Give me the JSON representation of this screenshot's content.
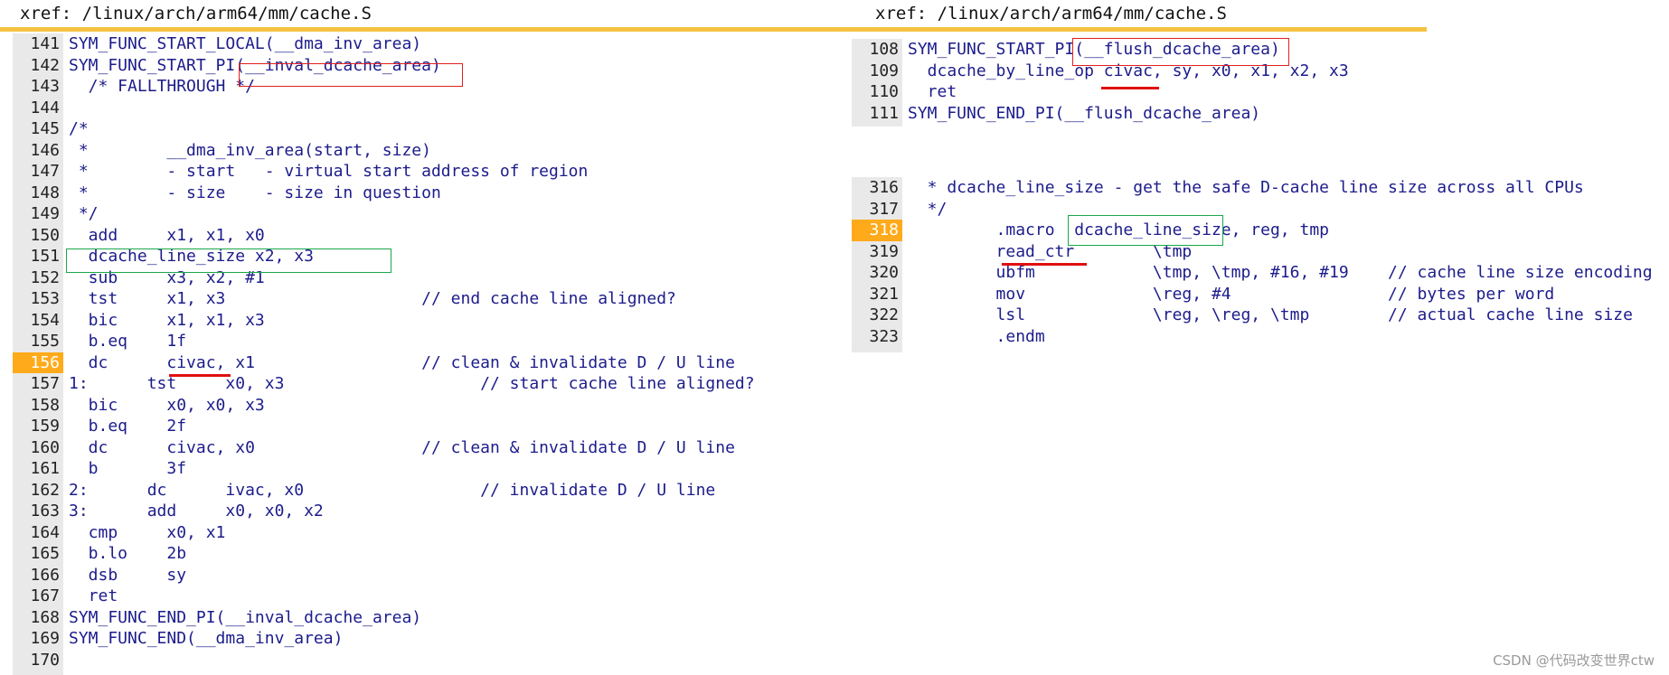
{
  "left": {
    "xref": {
      "prefix": "xref: ",
      "path": "/linux/arch/arm64/mm/cache.S"
    },
    "lines": [
      {
        "n": "141",
        "t": "SYM_FUNC_START_LOCAL(__dma_inv_area)"
      },
      {
        "n": "142",
        "t": "SYM_FUNC_START_PI(__inval_dcache_area)"
      },
      {
        "n": "143",
        "t": "  /* FALLTHROUGH */"
      },
      {
        "n": "144",
        "t": ""
      },
      {
        "n": "145",
        "t": "/*"
      },
      {
        "n": "146",
        "t": " *        __dma_inv_area(start, size)"
      },
      {
        "n": "147",
        "t": " *        - start   - virtual start address of region"
      },
      {
        "n": "148",
        "t": " *        - size    - size in question"
      },
      {
        "n": "149",
        "t": " */"
      },
      {
        "n": "150",
        "t": "  add     x1, x1, x0"
      },
      {
        "n": "151",
        "t": "  dcache_line_size x2, x3"
      },
      {
        "n": "152",
        "t": "  sub     x3, x2, #1"
      },
      {
        "n": "153",
        "t": "  tst     x1, x3                    // end cache line aligned?"
      },
      {
        "n": "154",
        "t": "  bic     x1, x1, x3"
      },
      {
        "n": "155",
        "t": "  b.eq    1f"
      },
      {
        "n": "156",
        "t": "  dc      civac, x1                 // clean & invalidate D / U line",
        "cur": true
      },
      {
        "n": "157",
        "t": "1:      tst     x0, x3                    // start cache line aligned?"
      },
      {
        "n": "158",
        "t": "  bic     x0, x0, x3"
      },
      {
        "n": "159",
        "t": "  b.eq    2f"
      },
      {
        "n": "160",
        "t": "  dc      civac, x0                 // clean & invalidate D / U line"
      },
      {
        "n": "161",
        "t": "  b       3f"
      },
      {
        "n": "162",
        "t": "2:      dc      ivac, x0                  // invalidate D / U line"
      },
      {
        "n": "163",
        "t": "3:      add     x0, x0, x2"
      },
      {
        "n": "164",
        "t": "  cmp     x0, x1"
      },
      {
        "n": "165",
        "t": "  b.lo    2b"
      },
      {
        "n": "166",
        "t": "  dsb     sy"
      },
      {
        "n": "167",
        "t": "  ret"
      },
      {
        "n": "168",
        "t": "SYM_FUNC_END_PI(__inval_dcache_area)"
      },
      {
        "n": "169",
        "t": "SYM_FUNC_END(__dma_inv_area)"
      },
      {
        "n": "170",
        "t": ""
      }
    ]
  },
  "right": {
    "xref": {
      "prefix": "xref: ",
      "path": "/linux/arch/arm64/mm/cache.S"
    },
    "block1": [
      {
        "n": "108",
        "t": "SYM_FUNC_START_PI(__flush_dcache_area)"
      },
      {
        "n": "109",
        "t": "  dcache_by_line_op civac, sy, x0, x1, x2, x3"
      },
      {
        "n": "110",
        "t": "  ret"
      },
      {
        "n": "111",
        "t": "SYM_FUNC_END_PI(__flush_dcache_area)"
      }
    ],
    "block2": [
      {
        "n": "316",
        "t": "  * dcache_line_size - get the safe D-cache line size across all CPUs"
      },
      {
        "n": "317",
        "t": "  */"
      },
      {
        "n": "318",
        "t": "         .macro  dcache_line_size, reg, tmp",
        "cur": true
      },
      {
        "n": "319",
        "t": "         read_ctr        \\tmp"
      },
      {
        "n": "320",
        "t": "         ubfm            \\tmp, \\tmp, #16, #19    // cache line size encoding"
      },
      {
        "n": "321",
        "t": "         mov             \\reg, #4                // bytes per word"
      },
      {
        "n": "322",
        "t": "         lsl             \\reg, \\reg, \\tmp        // actual cache line size"
      },
      {
        "n": "323",
        "t": "         .endm"
      }
    ]
  },
  "watermark": "CSDN @代码改变世界ctw",
  "colors": {
    "accent": "#f5c242",
    "current_line": "#ffaa1a",
    "box_red": "#e02020",
    "box_green": "#1aa84a",
    "highlight": "#ffff33"
  }
}
